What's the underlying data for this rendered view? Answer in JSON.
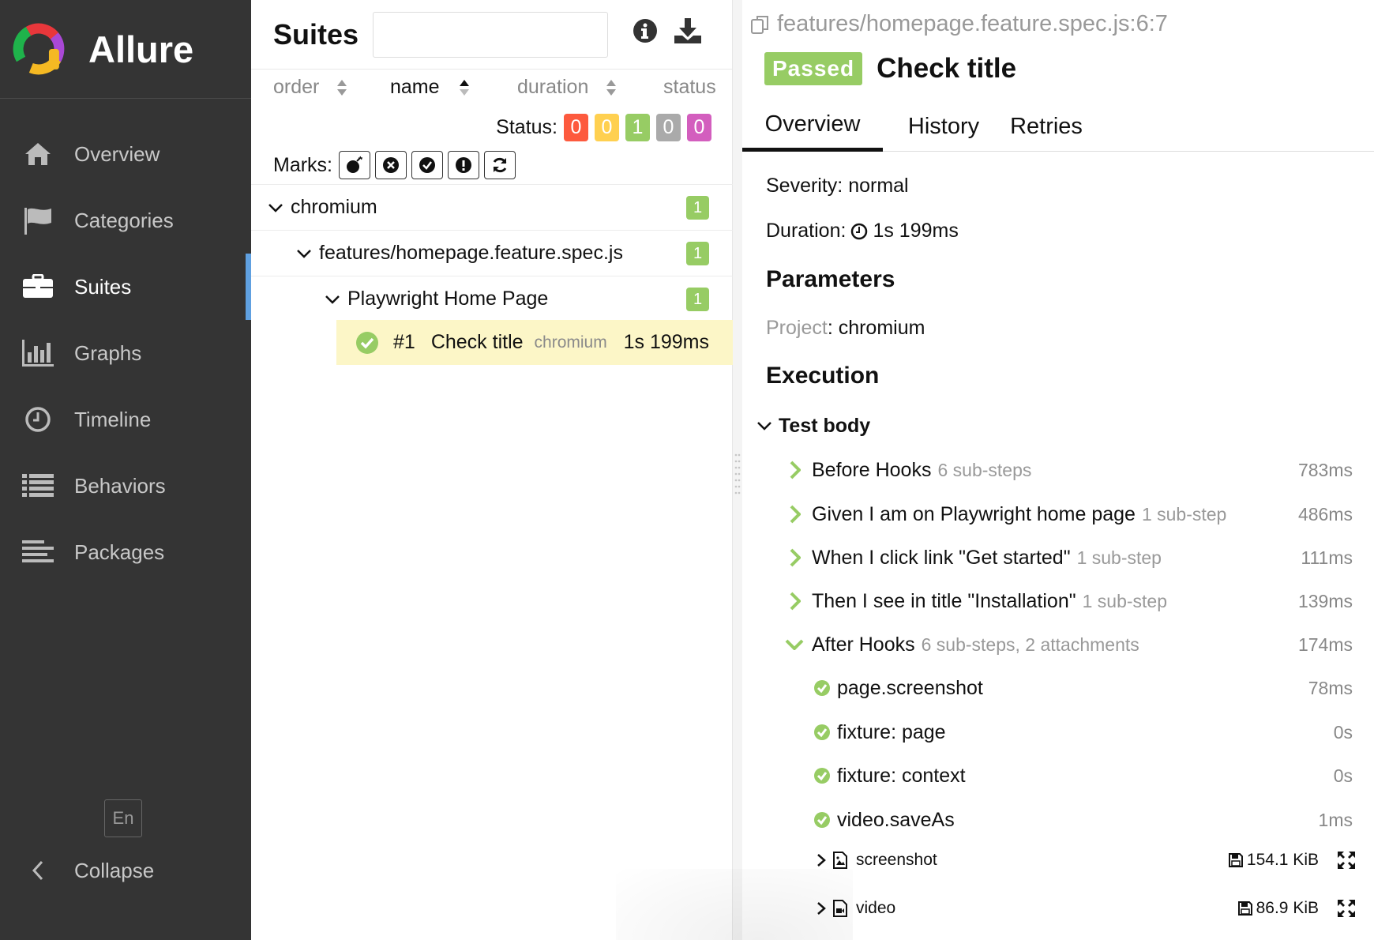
{
  "brand": {
    "name": "Allure"
  },
  "sidebar": {
    "items": [
      {
        "label": "Overview",
        "icon": "home-icon",
        "active": false
      },
      {
        "label": "Categories",
        "icon": "flag-icon",
        "active": false
      },
      {
        "label": "Suites",
        "icon": "briefcase-icon",
        "active": true
      },
      {
        "label": "Graphs",
        "icon": "bar-chart-icon",
        "active": false
      },
      {
        "label": "Timeline",
        "icon": "clock-icon",
        "active": false
      },
      {
        "label": "Behaviors",
        "icon": "list-icon",
        "active": false
      },
      {
        "label": "Packages",
        "icon": "align-left-icon",
        "active": false
      }
    ],
    "language": "En",
    "collapse_label": "Collapse"
  },
  "suites": {
    "title": "Suites",
    "search_value": "",
    "sort": {
      "order": "order",
      "name": "name",
      "duration": "duration",
      "status": "status"
    },
    "status_label": "Status:",
    "status_counts": [
      {
        "value": "0",
        "color": "#fd5a3e"
      },
      {
        "value": "0",
        "color": "#ffd050"
      },
      {
        "value": "1",
        "color": "#97cc64"
      },
      {
        "value": "0",
        "color": "#aaaaaa"
      },
      {
        "value": "0",
        "color": "#d35ebe"
      }
    ],
    "marks_label": "Marks:",
    "marks": [
      "bomb-icon",
      "times-circle-icon",
      "check-circle-icon",
      "exclamation-circle-icon",
      "refresh-icon"
    ],
    "tree": [
      {
        "label": "chromium",
        "count": "1"
      },
      {
        "label": "features/homepage.feature.spec.js",
        "count": "1"
      },
      {
        "label": "Playwright Home Page",
        "count": "1"
      }
    ],
    "leaf": {
      "order": "#1",
      "name": "Check title",
      "project": "chromium",
      "duration": "1s 199ms"
    }
  },
  "test": {
    "path": "features/homepage.feature.spec.js:6:7",
    "status": "Passed",
    "title": "Check title",
    "tabs": [
      "Overview",
      "History",
      "Retries"
    ],
    "severity": "Severity: normal",
    "duration_label": "Duration:",
    "duration": "1s 199ms",
    "parameters_title": "Parameters",
    "param_key": "Project",
    "param_value": ": chromium",
    "execution_title": "Execution",
    "test_body_label": "Test body",
    "steps": [
      {
        "name": "Before Hooks",
        "sub": "6 sub-steps",
        "duration": "783ms"
      },
      {
        "name": "Given I am on Playwright home page",
        "sub": "1 sub-step",
        "duration": "486ms"
      },
      {
        "name": "When I click link \"Get started\"",
        "sub": "1 sub-step",
        "duration": "111ms"
      },
      {
        "name": "Then I see in title \"Installation\"",
        "sub": "1 sub-step",
        "duration": "139ms"
      },
      {
        "name": "After Hooks",
        "sub": "6 sub-steps, 2 attachments",
        "duration": "174ms"
      }
    ],
    "after_substeps": [
      {
        "name": "page.screenshot",
        "duration": "78ms"
      },
      {
        "name": "fixture: page",
        "duration": "0s"
      },
      {
        "name": "fixture: context",
        "duration": "0s"
      },
      {
        "name": "video.saveAs",
        "duration": "1ms"
      }
    ],
    "attachments": [
      {
        "name": "screenshot",
        "size": "154.1 KiB"
      },
      {
        "name": "video",
        "size": "86.9 KiB"
      }
    ]
  },
  "colors": {
    "sidebar_bg": "#343434",
    "accent": "#5fa0e0",
    "passed": "#97cc64",
    "highlight": "#fcf6c7"
  }
}
